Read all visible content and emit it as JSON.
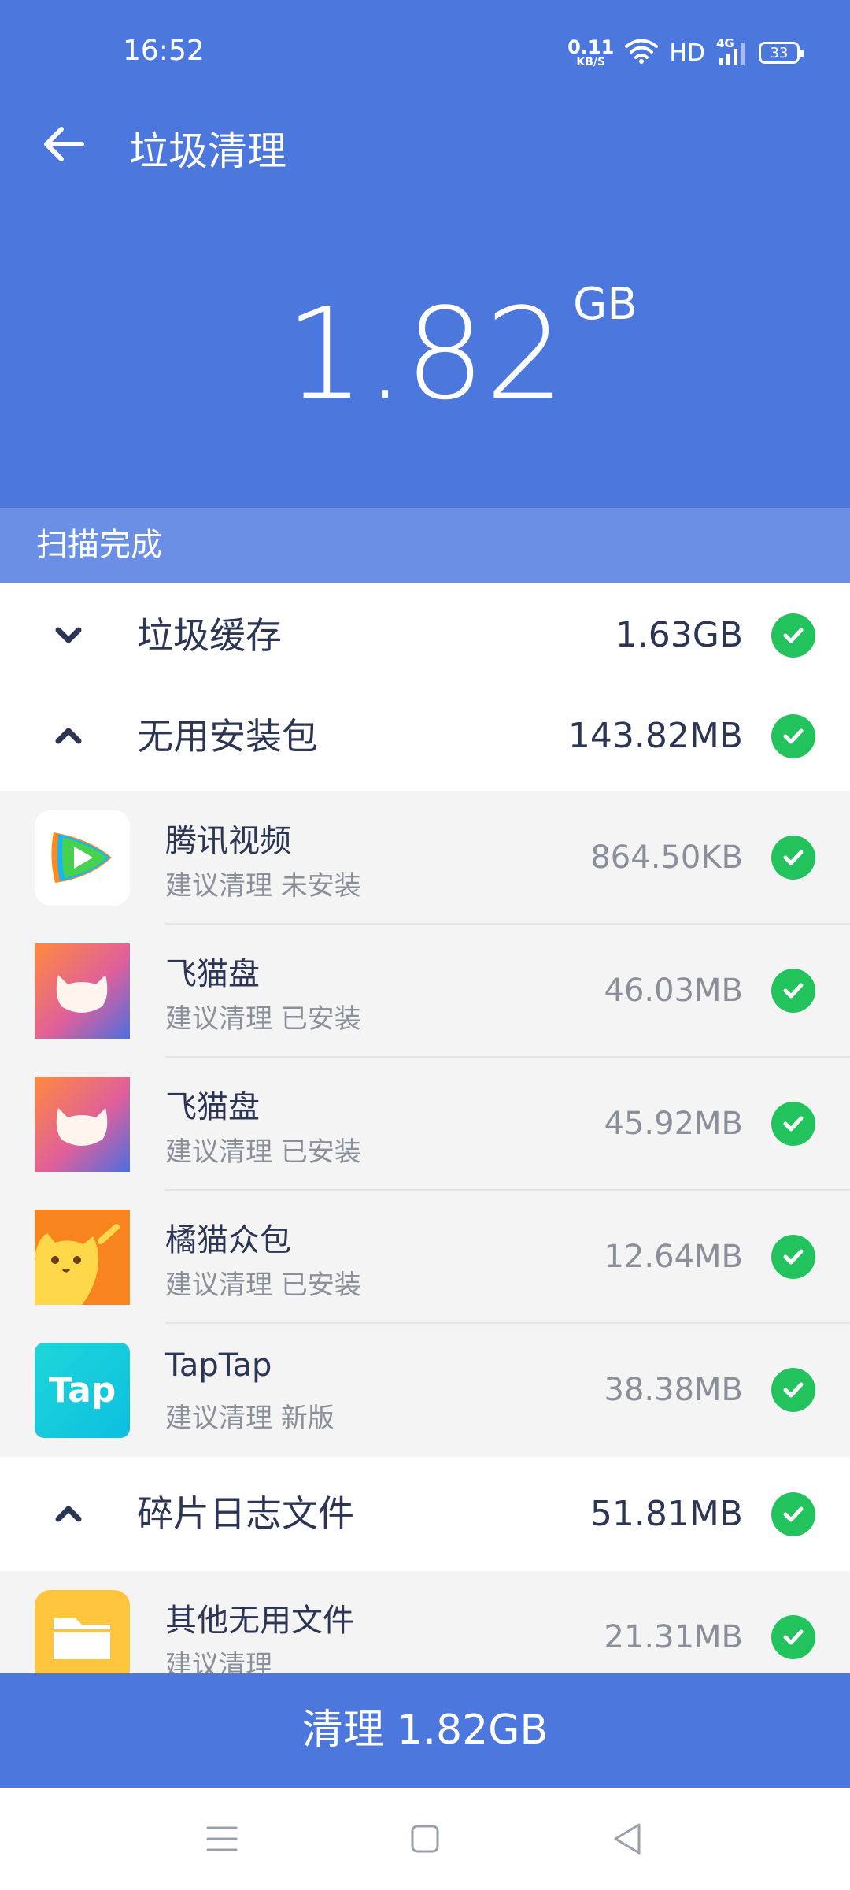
{
  "status_bar": {
    "time": "16:52",
    "net_speed_value": "0.11",
    "net_speed_unit": "KB/S",
    "hd_label": "HD",
    "network_type": "4G",
    "battery_level": "33"
  },
  "header": {
    "title": "垃圾清理",
    "total_size_value": "1.82",
    "total_size_unit": "GB"
  },
  "scan_status": "扫描完成",
  "categories": [
    {
      "name": "垃圾缓存",
      "size": "1.63GB",
      "expanded": false,
      "checked": true
    },
    {
      "name": "无用安装包",
      "size": "143.82MB",
      "expanded": true,
      "checked": true,
      "items": [
        {
          "name": "腾讯视频",
          "subtitle": "建议清理 未安装",
          "size": "864.50KB",
          "icon": "tencent-video-icon",
          "checked": true
        },
        {
          "name": "飞猫盘",
          "subtitle": "建议清理 已安装",
          "size": "46.03MB",
          "icon": "feimao-pan-icon",
          "checked": true
        },
        {
          "name": "飞猫盘",
          "subtitle": "建议清理 已安装",
          "size": "45.92MB",
          "icon": "feimao-pan-icon",
          "checked": true
        },
        {
          "name": "橘猫众包",
          "subtitle": "建议清理 已安装",
          "size": "12.64MB",
          "icon": "jumao-zhongbao-icon",
          "checked": true
        },
        {
          "name": "TapTap",
          "subtitle": "建议清理 新版",
          "size": "38.38MB",
          "icon": "taptap-icon",
          "icon_text": "Tap",
          "checked": true
        }
      ]
    },
    {
      "name": "碎片日志文件",
      "size": "51.81MB",
      "expanded": true,
      "checked": true,
      "items": [
        {
          "name": "其他无用文件",
          "subtitle": "建议清理",
          "size": "21.31MB",
          "icon": "folder-icon",
          "checked": true
        }
      ]
    }
  ],
  "clean_button_label": "清理 1.82GB",
  "colors": {
    "primary": "#4c77dd",
    "scan_bar": "#6b8fe5",
    "check_green": "#22c35c",
    "text_dark": "#2c3553",
    "text_muted": "#8a8f99"
  }
}
